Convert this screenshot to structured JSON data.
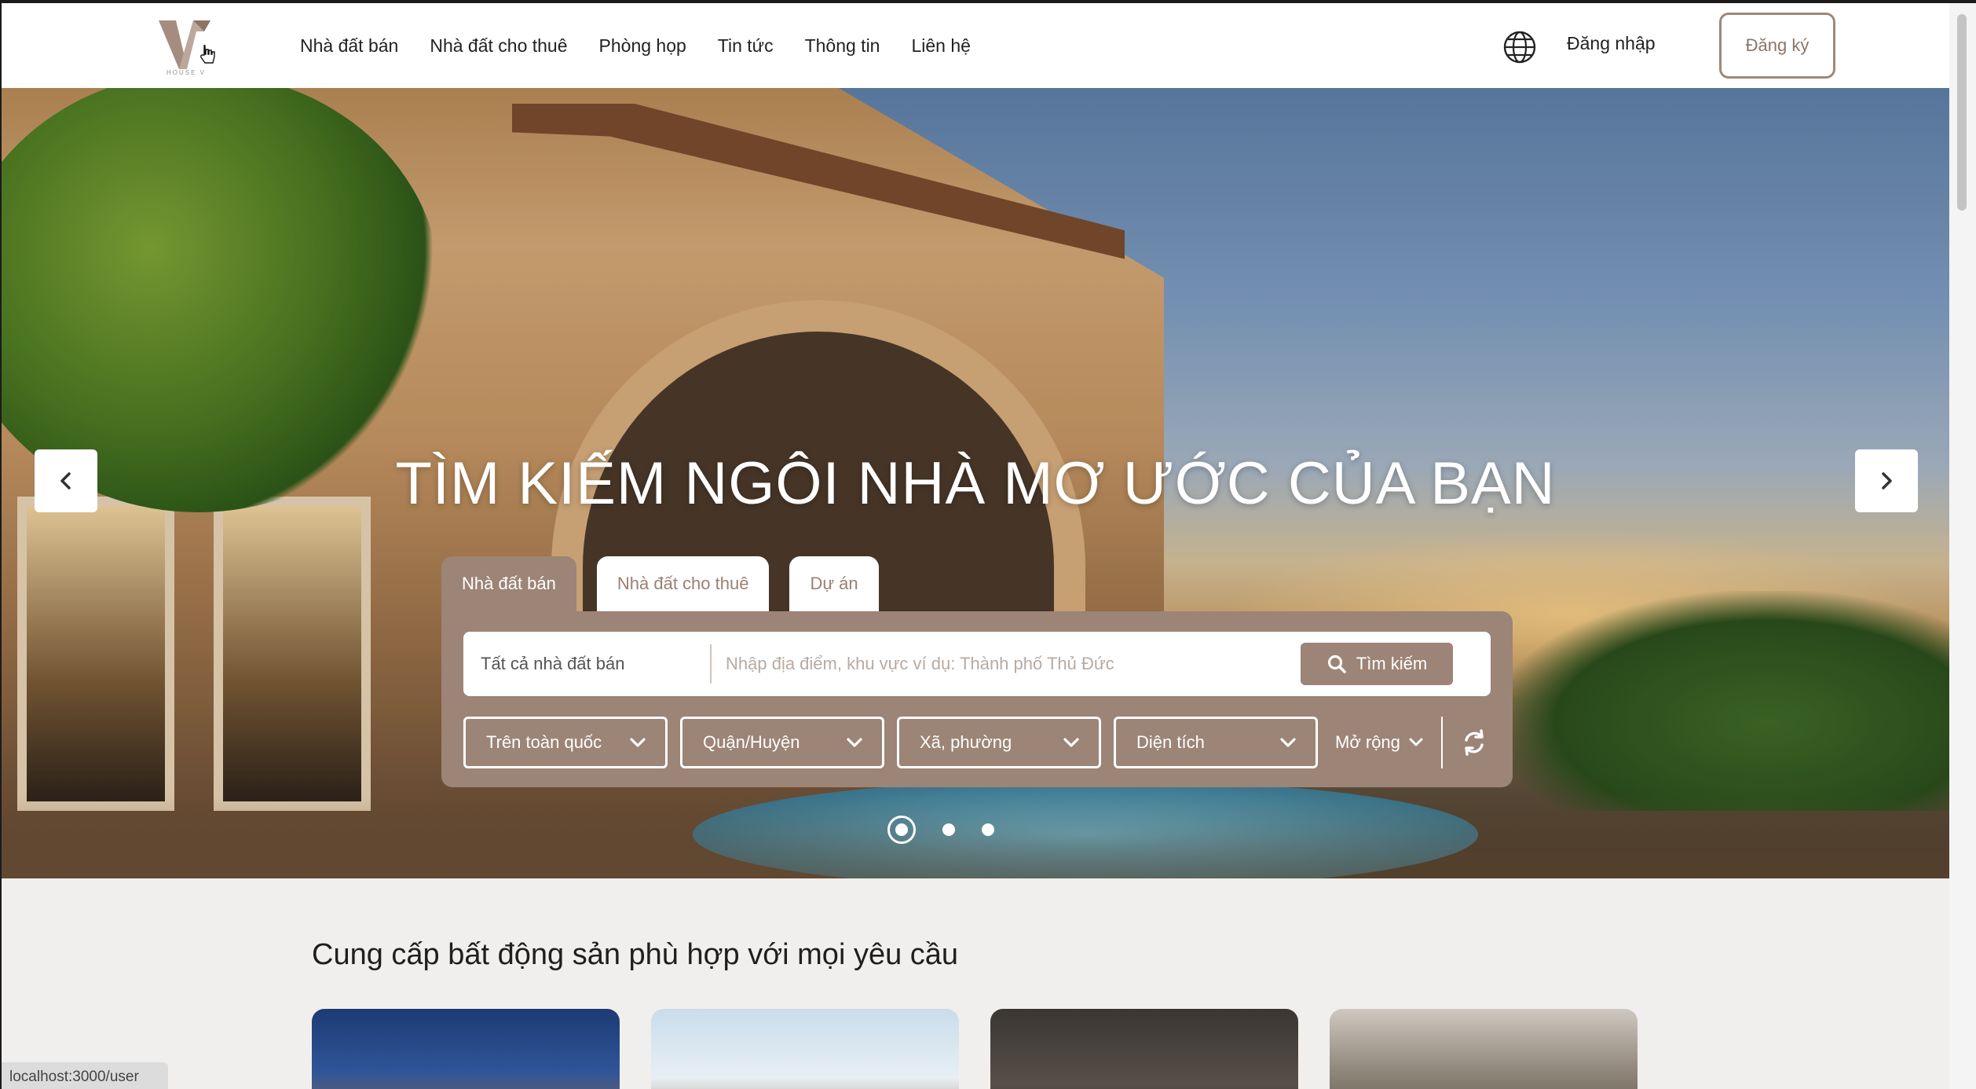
{
  "header": {
    "logo_text": "HOUSE V",
    "nav": [
      "Nhà đất bán",
      "Nhà đất cho thuê",
      "Phòng họp",
      "Tin tức",
      "Thông tin",
      "Liên hệ"
    ],
    "login_label": "Đăng nhập",
    "register_label": "Đăng ký",
    "language_icon": "globe-icon"
  },
  "hero": {
    "headline": "TÌM KIẾM NGÔI NHÀ MƠ ƯỚC CỦA BẠN",
    "prev_icon": "chevron-left-icon",
    "next_icon": "chevron-right-icon",
    "slides_total": 3,
    "active_slide": 1
  },
  "search": {
    "tabs": [
      {
        "label": "Nhà đất bán",
        "active": true
      },
      {
        "label": "Nhà đất cho thuê",
        "active": false
      },
      {
        "label": "Dự án",
        "active": false
      }
    ],
    "type_value": "Tất cả nhà đất bán",
    "placeholder": "Nhập địa điểm, khu vực ví dụ: Thành phố Thủ Đức",
    "button_label": "Tìm kiếm",
    "filters": [
      "Trên toàn quốc",
      "Quận/Huyện",
      "Xã, phường",
      "Diện tích"
    ],
    "more_label": "Mở rộng"
  },
  "section": {
    "title": "Cung cấp bất động sản phù hợp với mọi yêu cầu"
  },
  "status_bar": {
    "url": "localhost:3000/user"
  },
  "colors": {
    "accent": "#9c8476",
    "background": "#f1efed"
  }
}
